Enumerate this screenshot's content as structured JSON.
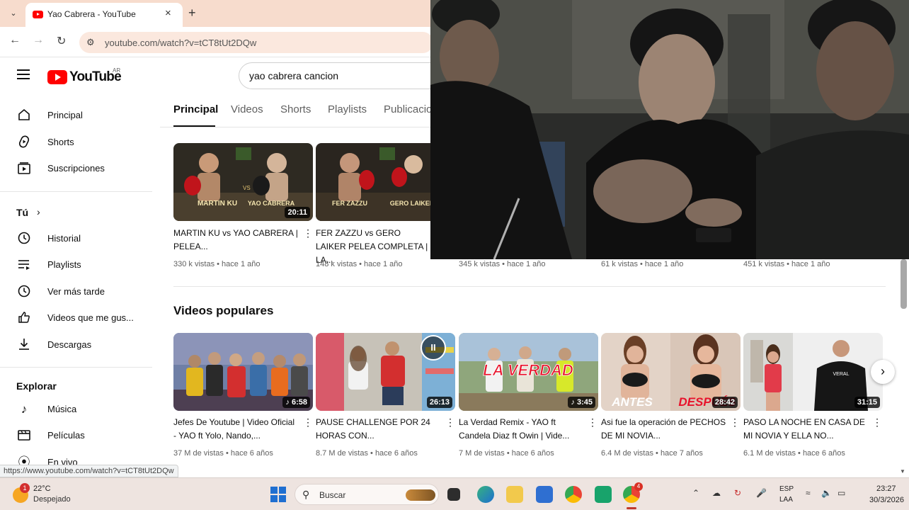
{
  "browser": {
    "tab_title": "Yao Cabrera - YouTube",
    "url": "youtube.com/watch?v=tCT8tUt2DQw",
    "status_url": "https://www.youtube.com/watch?v=tCT8tUt2DQw"
  },
  "youtube": {
    "logo_text": "YouTube",
    "country_code": "AR",
    "search_query": "yao cabrera cancion",
    "sidebar": {
      "main": [
        {
          "label": "Principal",
          "icon": "home-icon"
        },
        {
          "label": "Shorts",
          "icon": "shorts-icon"
        },
        {
          "label": "Suscripciones",
          "icon": "subscriptions-icon"
        }
      ],
      "you_heading": "Tú",
      "you": [
        {
          "label": "Historial",
          "icon": "history-icon"
        },
        {
          "label": "Playlists",
          "icon": "playlists-icon"
        },
        {
          "label": "Ver más tarde",
          "icon": "watch-later-icon"
        },
        {
          "label": "Videos que me gus...",
          "icon": "like-icon"
        },
        {
          "label": "Descargas",
          "icon": "download-icon"
        }
      ],
      "explore_heading": "Explorar",
      "explore": [
        {
          "label": "Música",
          "icon": "music-icon"
        },
        {
          "label": "Películas",
          "icon": "movies-icon"
        },
        {
          "label": "En vivo",
          "icon": "live-icon"
        }
      ]
    },
    "channel_tabs": [
      "Principal",
      "Videos",
      "Shorts",
      "Playlists",
      "Publicacio"
    ],
    "top_row": [
      {
        "title": "MARTIN KU vs YAO CABRERA | PELEA...",
        "meta": "330 k vistas • hace 1 año",
        "duration": "20:11"
      },
      {
        "title": "FER ZAZZU vs GERO LAIKER PELEA COMPLETA | LA...",
        "meta": "148 k vistas • hace 1 año",
        "duration": ""
      },
      {
        "title": "",
        "meta": "345 k vistas • hace 1 año",
        "duration": ""
      },
      {
        "title": "",
        "meta": "61 k vistas • hace 1 año",
        "duration": ""
      },
      {
        "title": "",
        "meta": "451 k vistas • hace 1 año",
        "duration": ""
      }
    ],
    "thumb_text": {
      "t1_left": "MARTIN KU",
      "t1_right": "YAO CABRERA",
      "t2_left": "FER ZAZZU",
      "t2_right": "GERO LAIKER",
      "t3": "LA VERDAD",
      "t4_left": "ANTES",
      "t4_right": "DESPUÉS",
      "t5": "VERAL"
    },
    "section_title": "Videos populares",
    "popular": [
      {
        "title": "Jefes De Youtube | Video Oficial - YAO ft Yolo, Nando,...",
        "meta": "37 M de vistas • hace 6 años",
        "duration": "6:58",
        "music": true
      },
      {
        "title": "PAUSE CHALLENGE POR 24 HORAS CON...",
        "meta": "8.7 M de vistas • hace 6 años",
        "duration": "26:13",
        "music": false
      },
      {
        "title": "La Verdad Remix - YAO ft Candela Diaz ft Owin | Vide...",
        "meta": "7 M de vistas • hace 6 años",
        "duration": "3:45",
        "music": true
      },
      {
        "title": "Asi fue la operación de PECHOS DE MI NOVIA...",
        "meta": "6.4 M de vistas • hace 7 años",
        "duration": "28:42",
        "music": false
      },
      {
        "title": "PASO LA NOCHE EN CASA DE MI NOVIA Y ELLA NO...",
        "meta": "6.1 M de vistas • hace 6 años",
        "duration": "31:15",
        "music": false
      }
    ]
  },
  "taskbar": {
    "weather_temp": "22°C",
    "weather_desc": "Despejado",
    "weather_badge": "1",
    "search_placeholder": "Buscar",
    "lang_line1": "ESP",
    "lang_line2": "LAA",
    "time": "23:27",
    "date": "30/3/2026",
    "chrome_badge": "4"
  }
}
